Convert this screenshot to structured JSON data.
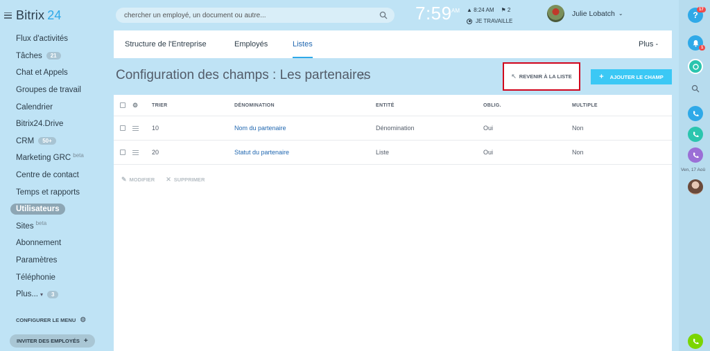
{
  "app": {
    "logo_text": "Bitrix",
    "logo_num": "24"
  },
  "search": {
    "placeholder": "chercher un employé, un document ou autre..."
  },
  "header": {
    "time": "7:59",
    "ampm": "AM",
    "alarm_time": "8:24 AM",
    "flag_count": "2",
    "status": "JE TRAVAILLE",
    "user_name": "Julie Lobatch"
  },
  "sidebar": {
    "items": [
      {
        "label": "Flux d'activités"
      },
      {
        "label": "Tâches",
        "badge": "21"
      },
      {
        "label": "Chat et Appels"
      },
      {
        "label": "Groupes de travail"
      },
      {
        "label": "Calendrier"
      },
      {
        "label": "Bitrix24.Drive"
      },
      {
        "label": "CRM",
        "badge": "50+"
      },
      {
        "label": "Marketing GRC",
        "sup": "beta"
      },
      {
        "label": "Centre de contact"
      },
      {
        "label": "Temps et rapports"
      },
      {
        "label": "Utilisateurs"
      },
      {
        "label": "Sites",
        "sup": "beta"
      },
      {
        "label": "Abonnement"
      },
      {
        "label": "Paramètres"
      },
      {
        "label": "Téléphonie"
      },
      {
        "label": "Plus...",
        "badge": "3"
      }
    ],
    "config_label": "CONFIGURER LE MENU",
    "invite_label": "INVITER DES EMPLOYÉS"
  },
  "tabs": {
    "structure": "Structure de l'Entreprise",
    "employes": "Employés",
    "listes": "Listes",
    "plus": "Plus"
  },
  "page": {
    "title": "Configuration des champs : Les partenaires",
    "back_label": "REVENIR À LA LISTE",
    "add_label": "AJOUTER LE CHAMP"
  },
  "table": {
    "headers": {
      "sort": "TRIER",
      "name": "DÉNOMINATION",
      "entity": "ENTITÉ",
      "required": "OBLIG.",
      "multiple": "MULTIPLE"
    },
    "rows": [
      {
        "sort": "10",
        "name": "Nom du partenaire",
        "entity": "Dénomination",
        "required": "Oui",
        "multiple": "Non"
      },
      {
        "sort": "20",
        "name": "Statut du partenaire",
        "entity": "Liste",
        "required": "Oui",
        "multiple": "Non"
      }
    ],
    "actions": {
      "edit": "MODIFIER",
      "delete": "SUPPRIMER"
    }
  },
  "right_sidebar": {
    "help_badge": "17",
    "notif_badge": "1",
    "date": "Ven, 17 Aoû"
  },
  "colors": {
    "background": "#bfe3f5",
    "accent": "#3bc8f5",
    "link": "#2067b0",
    "highlight_border": "#d0021b",
    "badge_red": "#ef4b4b"
  }
}
